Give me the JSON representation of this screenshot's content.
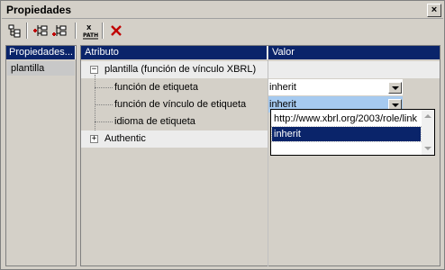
{
  "window": {
    "title": "Propiedades",
    "close_label": "×"
  },
  "toolbar": {
    "buttons": [
      "tree-layout-icon",
      "add-child-icon",
      "add-sibling-icon",
      "xpath-icon",
      "delete-icon"
    ],
    "xpath_text": "PATH"
  },
  "left_panel": {
    "header": "Propiedades...",
    "items": [
      {
        "label": "plantilla"
      }
    ]
  },
  "grid": {
    "columns": {
      "attribute": "Atributo",
      "value": "Valor"
    },
    "group": {
      "label": "plantilla (función de vínculo XBRL)",
      "expander": "−"
    },
    "rows": [
      {
        "attribute": "función de etiqueta",
        "value": "inherit"
      },
      {
        "attribute": "función de vínculo de etiqueta",
        "value": "inherit"
      },
      {
        "attribute": "idioma de etiqueta",
        "value": ""
      }
    ],
    "authentic": {
      "label": "Authentic",
      "expander": "+"
    }
  },
  "dropdown": {
    "options": [
      {
        "label": "http://www.xbrl.org/2003/role/link"
      },
      {
        "label": "inherit"
      }
    ],
    "selected_index": 1
  },
  "colors": {
    "header_bg": "#0a246a",
    "selection_bg": "#a6caf0"
  }
}
